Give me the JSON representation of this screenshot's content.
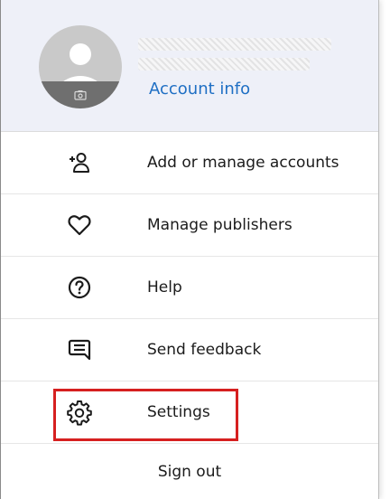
{
  "account": {
    "link_label": "Account info",
    "avatar_icon": "person-avatar-icon",
    "camera_icon": "camera-icon"
  },
  "menu": {
    "items": [
      {
        "label": "Add or manage accounts",
        "icon": "add-person-icon"
      },
      {
        "label": "Manage publishers",
        "icon": "heart-icon"
      },
      {
        "label": "Help",
        "icon": "help-circle-icon"
      },
      {
        "label": "Send feedback",
        "icon": "feedback-icon"
      },
      {
        "label": "Settings",
        "icon": "gear-icon"
      }
    ]
  },
  "footer": {
    "signout_label": "Sign out"
  },
  "colors": {
    "header_bg": "#eef0f8",
    "link": "#1f6fc4",
    "highlight_border": "#d62020"
  }
}
